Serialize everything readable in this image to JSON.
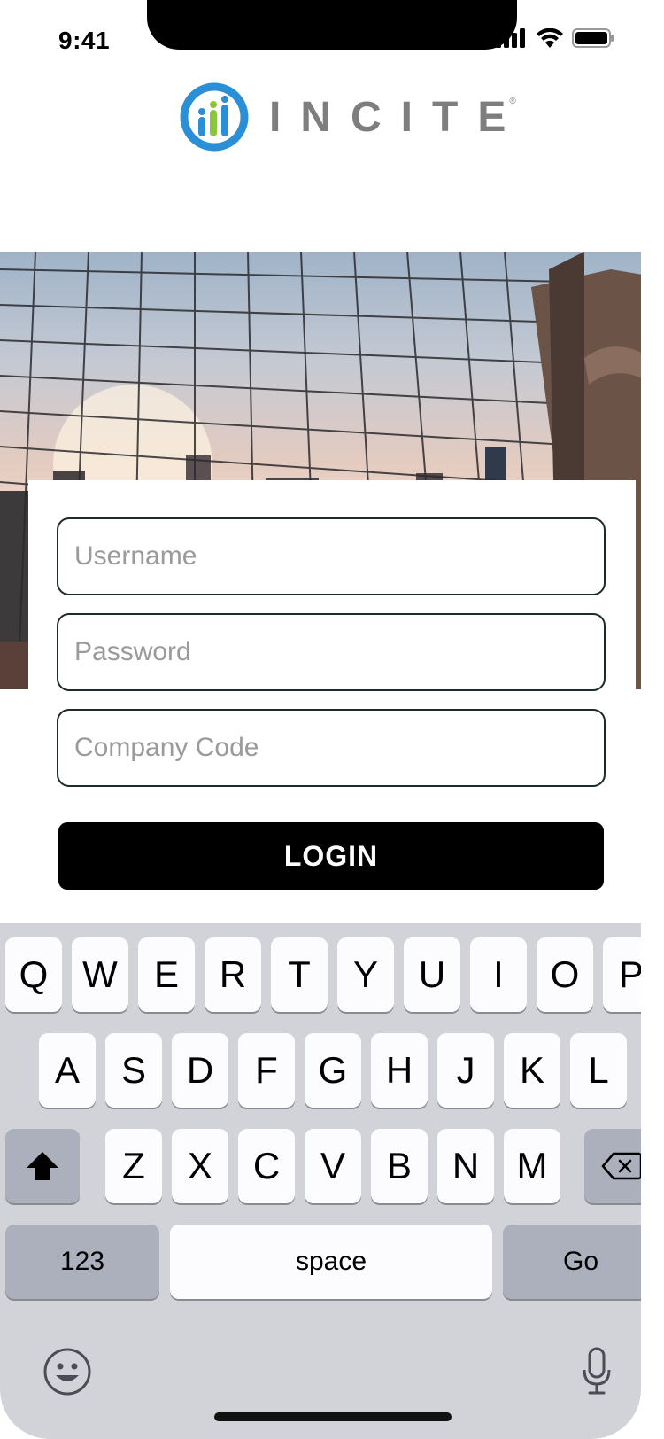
{
  "status_bar": {
    "time": "9:41"
  },
  "brand": {
    "name": "INCITE",
    "registered": "®"
  },
  "form": {
    "username_placeholder": "Username",
    "password_placeholder": "Password",
    "company_code_placeholder": "Company Code",
    "login_label": "LOGIN"
  },
  "keyboard": {
    "row1": [
      "Q",
      "W",
      "E",
      "R",
      "T",
      "Y",
      "U",
      "I",
      "O",
      "P"
    ],
    "row2": [
      "A",
      "S",
      "D",
      "F",
      "G",
      "H",
      "J",
      "K",
      "L"
    ],
    "row3": [
      "Z",
      "X",
      "C",
      "V",
      "B",
      "N",
      "M"
    ],
    "numbers_label": "123",
    "space_label": "space",
    "go_label": "Go"
  },
  "colors": {
    "logo_blue": "#2a8fd6",
    "logo_green": "#8cc63f",
    "logo_gray": "#7e7e7e"
  }
}
